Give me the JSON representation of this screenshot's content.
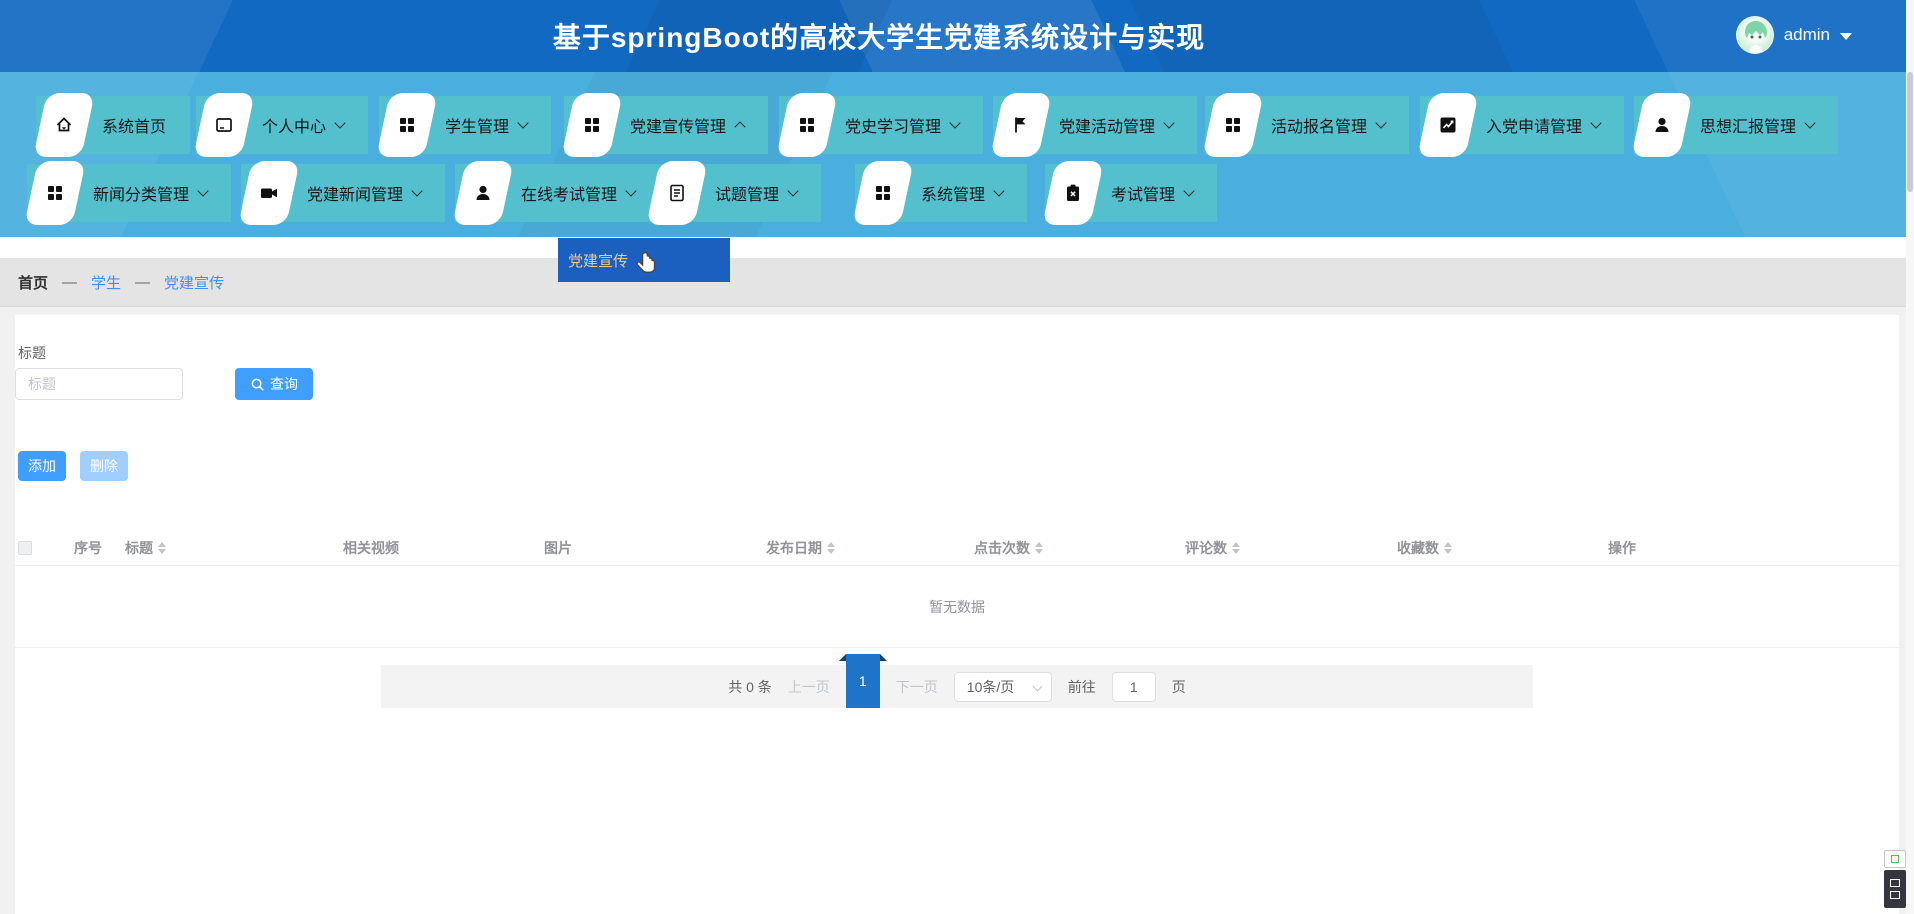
{
  "header": {
    "title": "基于springBoot的高校大学生党建系统设计与实现",
    "username": "admin"
  },
  "nav": {
    "row1": [
      {
        "label": "系统首页",
        "icon": "home-icon",
        "chevron": "none"
      },
      {
        "label": "个人中心",
        "icon": "id-card-icon",
        "chevron": "down"
      },
      {
        "label": "学生管理",
        "icon": "grid-icon",
        "chevron": "down"
      },
      {
        "label": "党建宣传管理",
        "icon": "grid-icon",
        "chevron": "up"
      },
      {
        "label": "党史学习管理",
        "icon": "grid-icon",
        "chevron": "down"
      },
      {
        "label": "党建活动管理",
        "icon": "flag-icon",
        "chevron": "down"
      },
      {
        "label": "活动报名管理",
        "icon": "grid-icon",
        "chevron": "down"
      },
      {
        "label": "入党申请管理",
        "icon": "chart-icon",
        "chevron": "down"
      },
      {
        "label": "思想汇报管理",
        "icon": "user-icon",
        "chevron": "down"
      }
    ],
    "row2": [
      {
        "label": "新闻分类管理",
        "icon": "grid-icon",
        "chevron": "down"
      },
      {
        "label": "党建新闻管理",
        "icon": "video-icon",
        "chevron": "down"
      },
      {
        "label": "在线考试管理",
        "icon": "user-icon",
        "chevron": "down"
      },
      {
        "label": "试题管理",
        "icon": "doc-icon",
        "chevron": "down"
      },
      {
        "label": "系统管理",
        "icon": "grid-icon",
        "chevron": "down"
      },
      {
        "label": "考试管理",
        "icon": "clipboard-icon",
        "chevron": "down"
      }
    ]
  },
  "dropdown": {
    "item": "党建宣传"
  },
  "breadcrumb": {
    "home": "首页",
    "sep1": "—",
    "link1": "学生",
    "sep2": "—",
    "link2": "党建宣传"
  },
  "search": {
    "label": "标题",
    "placeholder": "标题",
    "button": "查询"
  },
  "toolbar": {
    "add": "添加",
    "delete": "删除"
  },
  "table": {
    "columns": [
      {
        "label": "序号",
        "sortable": false
      },
      {
        "label": "标题",
        "sortable": true
      },
      {
        "label": "相关视频",
        "sortable": false
      },
      {
        "label": "图片",
        "sortable": false
      },
      {
        "label": "发布日期",
        "sortable": true
      },
      {
        "label": "点击次数",
        "sortable": true
      },
      {
        "label": "评论数",
        "sortable": true
      },
      {
        "label": "收藏数",
        "sortable": true
      },
      {
        "label": "操作",
        "sortable": false
      }
    ],
    "empty_text": "暂无数据"
  },
  "pagination": {
    "total": "共 0 条",
    "prev": "上一页",
    "current_page": "1",
    "next": "下一页",
    "page_size": "10条/页",
    "goto_label": "前往",
    "goto_value": "1",
    "page_label": "页"
  },
  "colors": {
    "header_blue": "#1269c2",
    "nav_blue": "#4aaede",
    "nav_tile_teal": "#55c0cd",
    "dropdown_blue": "#1b5fbf",
    "dropdown_text_gold": "#f0cd8a",
    "accent_blue": "#409eff",
    "delete_pale_blue": "#a0cfff",
    "active_page_blue": "#1d74c8",
    "breadcrumb_bg": "#e4e4e4",
    "link_blue": "#3e8ef0"
  }
}
